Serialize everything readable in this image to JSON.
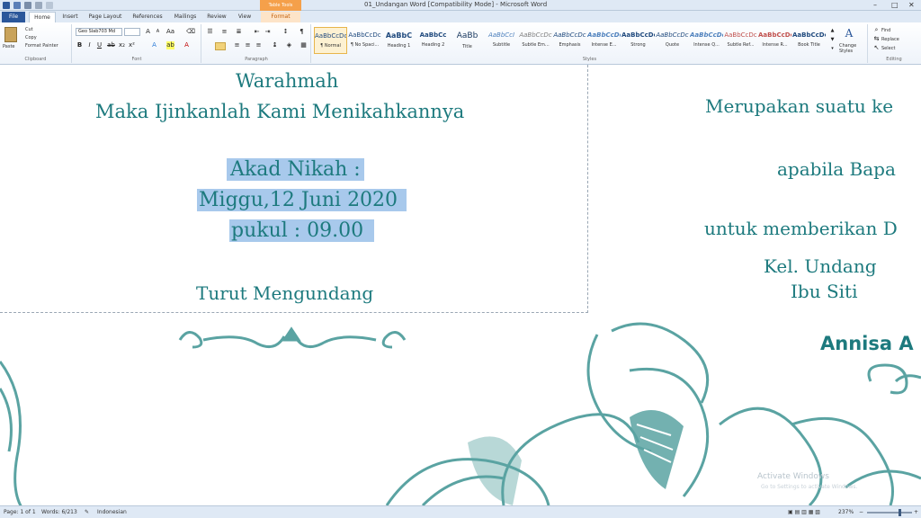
{
  "window": {
    "title": "01_Undangan Word [Compatibility Mode] - Microsoft Word",
    "context_tab_group": "Table Tools",
    "controls": {
      "minimize": "–",
      "maximize": "□",
      "close": "✕"
    }
  },
  "tabs": [
    "File",
    "Home",
    "Insert",
    "Page Layout",
    "References",
    "Mailings",
    "Review",
    "View",
    "Format"
  ],
  "ribbon": {
    "clipboard": {
      "paste": "Paste",
      "cut": "Cut",
      "copy": "Copy",
      "format_painter": "Format Painter",
      "label": "Clipboard"
    },
    "font": {
      "name": "Geo Slab703 Md",
      "size": "",
      "label": "Font"
    },
    "paragraph": {
      "label": "Paragraph"
    },
    "styles": {
      "label": "Styles",
      "items": [
        {
          "sample": "AaBbCcDc",
          "name": "¶ Normal"
        },
        {
          "sample": "AaBbCcDc",
          "name": "¶ No Spaci..."
        },
        {
          "sample": "AaBbC",
          "name": "Heading 1"
        },
        {
          "sample": "AaBbCc",
          "name": "Heading 2"
        },
        {
          "sample": "AaBb",
          "name": "Title"
        },
        {
          "sample": "AaBbCcI",
          "name": "Subtitle"
        },
        {
          "sample": "AaBbCcDc",
          "name": "Subtle Em..."
        },
        {
          "sample": "AaBbCcDc",
          "name": "Emphasis"
        },
        {
          "sample": "AaBbCcDc",
          "name": "Intense E..."
        },
        {
          "sample": "AaBbCcDc",
          "name": "Strong"
        },
        {
          "sample": "AaBbCcDc",
          "name": "Quote"
        },
        {
          "sample": "AaBbCcDc",
          "name": "Intense Q..."
        },
        {
          "sample": "AaBbCcDc",
          "name": "Subtle Ref..."
        },
        {
          "sample": "AaBbCcDc",
          "name": "Intense R..."
        },
        {
          "sample": "AaBbCcDc",
          "name": "Book Title"
        }
      ],
      "change_styles": "Change Styles"
    },
    "editing": {
      "find": "Find",
      "replace": "Replace",
      "select": "Select",
      "label": "Editing"
    }
  },
  "document": {
    "left": {
      "line1": "Warahmah",
      "line2": "Maka Ijinkanlah Kami Menikahkannya",
      "akad1": "Akad Nikah :",
      "akad2": "Miggu,12 Juni 2020",
      "akad3": "pukul : 09.00",
      "turut": "Turut Mengundang"
    },
    "right": {
      "line1": "Merupakan suatu ke",
      "line2": "apabila Bapa",
      "line3": "untuk memberikan D",
      "line4": "Kel. Undang",
      "line5": "Ibu Siti",
      "line6": "Annisa A"
    }
  },
  "watermark": {
    "title": "Activate Windows",
    "subtitle": "Go to Settings to activate Windows."
  },
  "statusbar": {
    "page": "Page: 1 of 1",
    "words": "Words: 6/213",
    "language": "Indonesian",
    "zoom": "237%"
  },
  "colors": {
    "teal": "#1d7a7e",
    "ornament": "#5aa3a2",
    "highlight": "#a8c9ec"
  }
}
